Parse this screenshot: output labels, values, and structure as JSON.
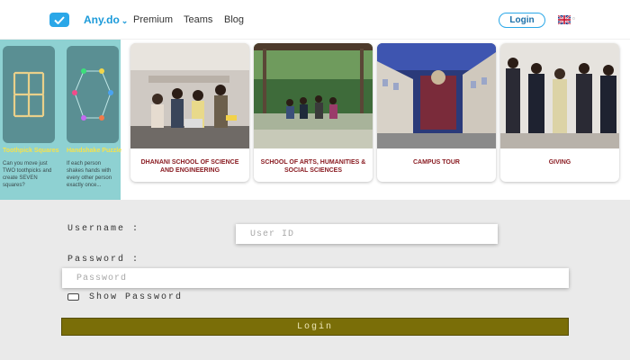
{
  "nav": {
    "brand": "Any.do",
    "links": [
      "Premium",
      "Teams",
      "Blog"
    ],
    "login_label": "Login",
    "lang_suffix": "▫"
  },
  "puzzles": [
    {
      "title": "Toothpick Squares",
      "desc": "Can you move just TWO toothpicks and create SEVEN squares?"
    },
    {
      "title": "Handshake Puzzle",
      "desc": "If each person shakes hands with every other person exactly once..."
    }
  ],
  "cards": [
    {
      "caption": "DHANANI SCHOOL OF SCIENCE AND ENGINEERING"
    },
    {
      "caption": "SCHOOL OF ARTS, HUMANITIES & SOCIAL SCIENCES"
    },
    {
      "caption": "CAMPUS TOUR"
    },
    {
      "caption": "GIVING"
    }
  ],
  "form": {
    "username_label": "Username :",
    "username_placeholder": "User ID",
    "password_label": "Password :",
    "password_placeholder": "Password",
    "show_password_label": "Show Password",
    "login_button": "Login"
  },
  "colors": {
    "brand_blue": "#2aa7e8",
    "teal": "#8ed1d2",
    "caption_red": "#8a1c22",
    "login_olive": "#7a6e08"
  }
}
